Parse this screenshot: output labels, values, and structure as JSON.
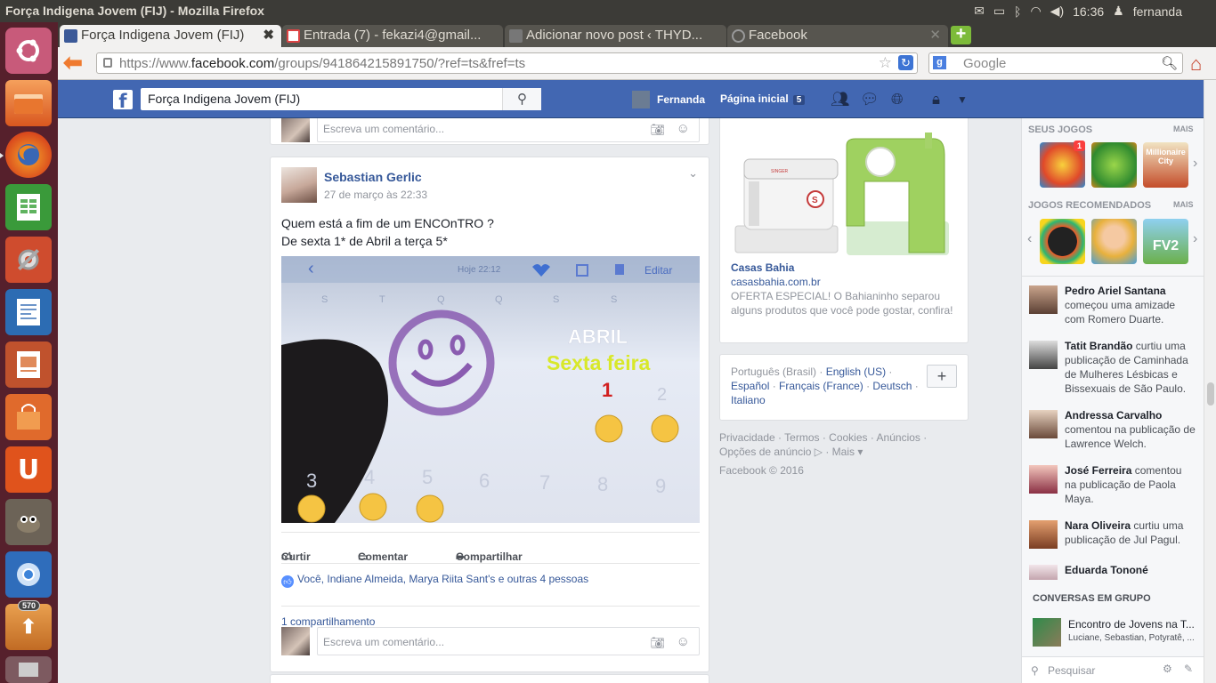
{
  "os": {
    "window_title": "Força Indigena Jovem (FIJ) - Mozilla Firefox",
    "clock": "16:36",
    "user": "fernanda",
    "launcher_badge": "570"
  },
  "tabs": [
    {
      "label": "Força Indigena Jovem (FIJ)",
      "close": "✖"
    },
    {
      "label": "Entrada (7) - fekazi4@gmail...",
      "close": "✕"
    },
    {
      "label": "Adicionar novo post ‹ THYD...",
      "close": "✕"
    },
    {
      "label": "Facebook",
      "close": "✕"
    }
  ],
  "browser": {
    "url_prefix": "https://www.",
    "url_domain": "facebook.com",
    "url_path": "/groups/941864215891750/?ref=ts&fref=ts",
    "search_placeholder": "Google"
  },
  "fb": {
    "search_value": "Força Indigena Jovem (FIJ)",
    "user_name": "Fernanda",
    "home_label": "Página inicial",
    "home_count": "5"
  },
  "feed": {
    "comment_placeholder": "Escreva um comentário...",
    "post": {
      "author": "Sebastian Gerlic",
      "date": "27 de março às 22:33",
      "text_line1": "Quem está a fim de um ENCOnTRO ?",
      "text_line2": "De sexta 1* de Abril a terça 5*",
      "photo": {
        "time": "Hoje 22:12",
        "edit": "Editar",
        "weekdays": [
          "S",
          "T",
          "Q",
          "Q",
          "S",
          "S"
        ],
        "month": "ABRIL",
        "day_label": "Sexta feira",
        "day1": "1",
        "day2": "2",
        "row_numbers": [
          "3",
          "4",
          "5",
          "6",
          "7",
          "8",
          "9"
        ]
      },
      "like_label": "Curtir",
      "comment_label": "Comentar",
      "share_label": "Compartilhar",
      "likes_text": "Você, Indiane Almeida, Marya Riita Sant's e outras 4 pessoas",
      "shares_text": "1 compartilhamento"
    }
  },
  "ad": {
    "title": "Casas Bahia",
    "domain": "casasbahia.com.br",
    "description": "OFERTA ESPECIAL! O Bahianinho separou alguns produtos que você pode gostar, confira!",
    "brand_on_machine": "SINGER"
  },
  "languages": {
    "current": "Português (Brasil)",
    "links": [
      "English (US)",
      "Español",
      "Français (France)",
      "Deutsch",
      "Italiano"
    ],
    "sep": " · ",
    "add": "+"
  },
  "footer": {
    "links": [
      "Privacidade",
      "Termos",
      "Cookies",
      "Anúncios",
      "Opções de anúncio"
    ],
    "more": "Mais",
    "copyright": "Facebook © 2016"
  },
  "sidebar": {
    "your_games": "SEUS JOGOS",
    "more": "MAIS",
    "game_badge": "1",
    "game3_text": "Millionaire City",
    "recommended": "JOGOS RECOMENDADOS",
    "rec3_text": "FV2",
    "ticker": [
      {
        "name": "Pedro Ariel Santana",
        "text": "começou uma amizade com Romero Duarte."
      },
      {
        "name": "Tatit Brandão",
        "text": "curtiu uma publicação de Caminhada de Mulheres Lésbicas e Bissexuais de São Paulo."
      },
      {
        "name": "Andressa Carvalho",
        "text": "comentou na publicação de Lawrence Welch."
      },
      {
        "name": "José Ferreira",
        "text": "comentou na publicação de Paola Maya."
      },
      {
        "name": "Nara Oliveira",
        "text": "curtiu uma publicação de Jul Pagul."
      },
      {
        "name": "Eduarda Tononé",
        "text": ""
      }
    ],
    "group_chats": "CONVERSAS EM GRUPO",
    "chat_name": "Encontro de Jovens na T...",
    "chat_members": "Luciane, Sebastian, Potyratê, ...",
    "chat_search": "Pesquisar"
  }
}
